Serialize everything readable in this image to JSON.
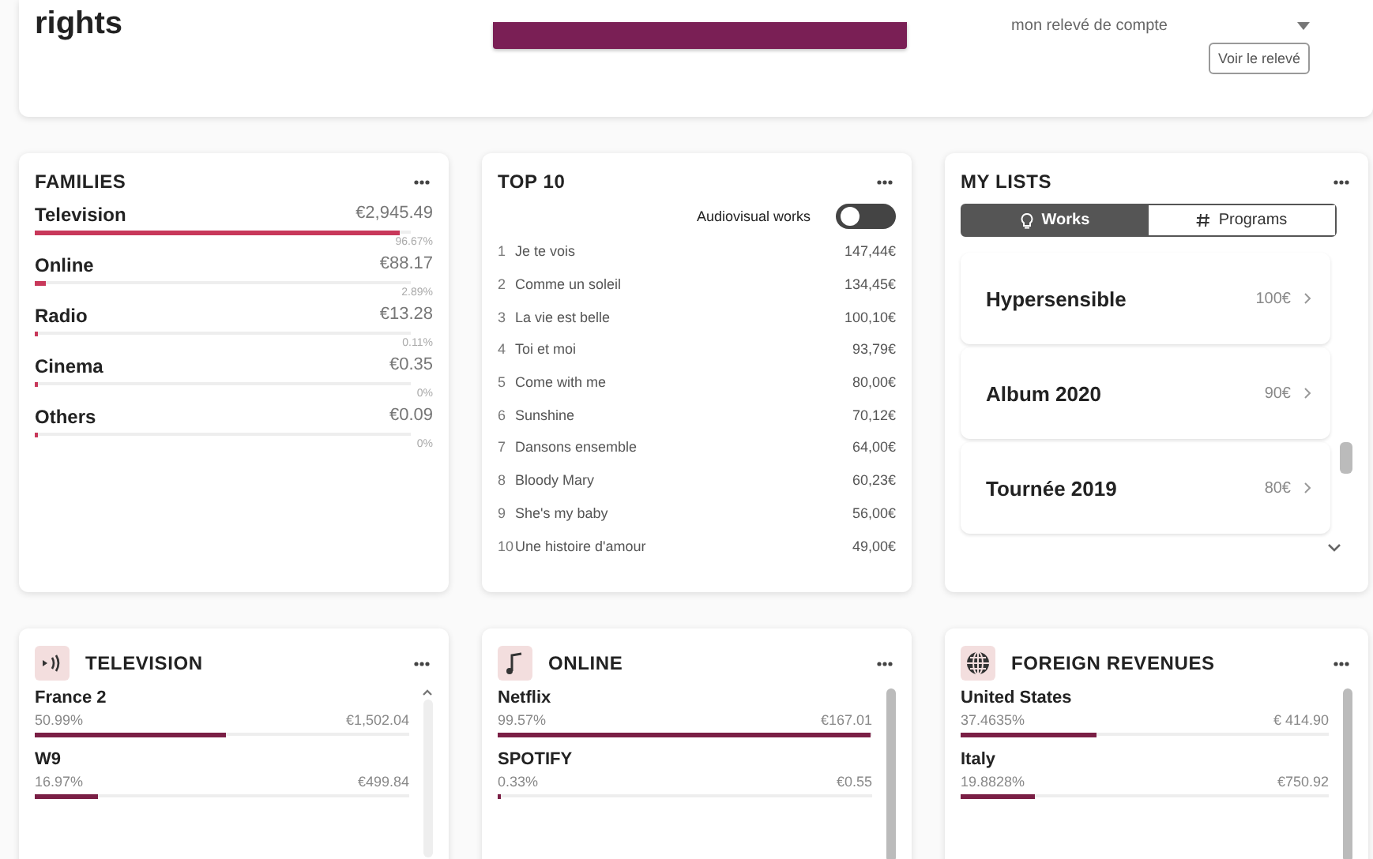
{
  "header": {
    "title": "rights",
    "statement": {
      "value": "mon relevé de compte",
      "button": "Voir le relevé"
    }
  },
  "families": {
    "title": "FAMILIES",
    "items": [
      {
        "name": "Television",
        "amount": "€2,945.49",
        "percent": "96.67%",
        "level": 0.97
      },
      {
        "name": "Online",
        "amount": "€88.17",
        "percent": "2.89%",
        "level": 0.03
      },
      {
        "name": "Radio",
        "amount": "€13.28",
        "percent": "0.11%",
        "level": 0.0
      },
      {
        "name": "Cinema",
        "amount": "€0.35",
        "percent": "0%",
        "level": 0
      },
      {
        "name": "Others",
        "amount": "€0.09",
        "percent": "0%",
        "level": 0
      }
    ]
  },
  "top10": {
    "title": "TOP 10",
    "toggle": {
      "label": "Audiovisual works",
      "on": false
    },
    "items": [
      {
        "rank": "1",
        "title": "Je te vois",
        "amount": "147,44€"
      },
      {
        "rank": "2",
        "title": "Comme un soleil",
        "amount": "134,45€"
      },
      {
        "rank": "3",
        "title": "La vie est belle",
        "amount": "100,10€"
      },
      {
        "rank": "4",
        "title": "Toi et moi",
        "amount": "93,79€"
      },
      {
        "rank": "5",
        "title": "Come with me",
        "amount": "80,00€"
      },
      {
        "rank": "6",
        "title": "Sunshine",
        "amount": "70,12€"
      },
      {
        "rank": "7",
        "title": "Dansons ensemble",
        "amount": "64,00€"
      },
      {
        "rank": "8",
        "title": "Bloody Mary",
        "amount": "60,23€"
      },
      {
        "rank": "9",
        "title": "She's my baby",
        "amount": "56,00€"
      },
      {
        "rank": "10",
        "title": "Une histoire d'amour",
        "amount": "49,00€"
      }
    ]
  },
  "my_lists": {
    "title": "MY LISTS",
    "tabs": [
      {
        "label": "Works",
        "kind": "works",
        "selected": true
      },
      {
        "label": "Programs",
        "kind": "programs",
        "selected": false
      }
    ],
    "items": [
      {
        "name": "Hypersensible",
        "amount": "100€"
      },
      {
        "name": "Album 2020",
        "amount": "90€"
      },
      {
        "name": "Tournée 2019",
        "amount": "80€"
      }
    ]
  },
  "breakdowns": [
    {
      "title": "TELEVISION",
      "kind": "television",
      "items": [
        {
          "name": "France 2",
          "percent": "50.99%",
          "amount": "€1,502.04",
          "level": 0.51
        },
        {
          "name": "W9",
          "percent": "16.97%",
          "amount": "€499.84",
          "level": 0.17
        }
      ]
    },
    {
      "title": "ONLINE",
      "kind": "online",
      "items": [
        {
          "name": "Netflix",
          "percent": "99.57%",
          "amount": "€167.01",
          "level": 0.996
        },
        {
          "name": "SPOTIFY",
          "percent": "0.33%",
          "amount": "€0.55",
          "level": 0.004
        }
      ]
    },
    {
      "title": "FOREIGN REVENUES",
      "kind": "foreign",
      "items": [
        {
          "name": "United States",
          "percent": "37.4635%",
          "amount": "€ 414.90",
          "level": 0.37
        },
        {
          "name": "Italy",
          "percent": "19.8828%",
          "amount": "€750.92",
          "level": 0.2
        }
      ]
    }
  ]
}
